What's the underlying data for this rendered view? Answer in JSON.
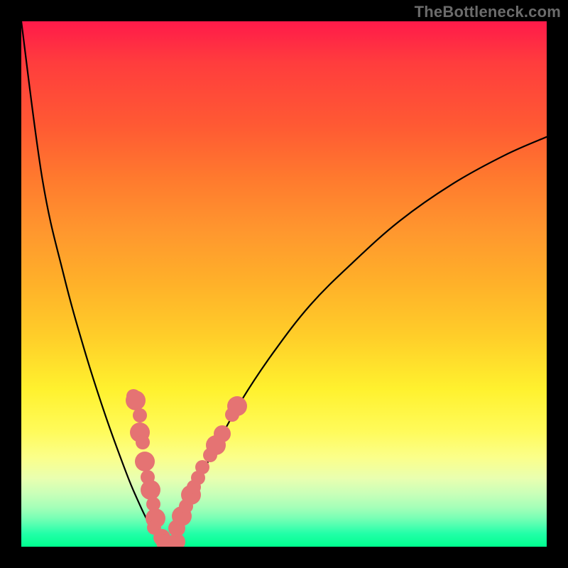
{
  "watermark": "TheBottleneck.com",
  "chart_data": {
    "type": "line",
    "title": "",
    "xlabel": "",
    "ylabel": "",
    "xlim": [
      0,
      1
    ],
    "ylim": [
      0,
      1
    ],
    "grid": false,
    "series": [
      {
        "name": "left-arm",
        "x": [
          0.0,
          0.04,
          0.08,
          0.12,
          0.16,
          0.2,
          0.22,
          0.24,
          0.26,
          0.272,
          0.28
        ],
        "y": [
          1.0,
          0.7,
          0.52,
          0.375,
          0.25,
          0.14,
          0.092,
          0.05,
          0.02,
          0.003,
          0.0
        ]
      },
      {
        "name": "right-arm",
        "x": [
          0.28,
          0.3,
          0.33,
          0.37,
          0.42,
          0.48,
          0.55,
          0.63,
          0.72,
          0.82,
          0.92,
          1.0
        ],
        "y": [
          0.0,
          0.045,
          0.11,
          0.19,
          0.28,
          0.37,
          0.46,
          0.54,
          0.62,
          0.69,
          0.745,
          0.78
        ]
      }
    ],
    "dots": {
      "name": "highlighted-range",
      "color": "#e57373",
      "points": [
        {
          "x": 0.214,
          "y": 0.287,
          "r": 10
        },
        {
          "x": 0.217,
          "y": 0.279,
          "r": 14
        },
        {
          "x": 0.226,
          "y": 0.25,
          "r": 10
        },
        {
          "x": 0.225,
          "y": 0.217,
          "r": 14
        },
        {
          "x": 0.231,
          "y": 0.198,
          "r": 10
        },
        {
          "x": 0.235,
          "y": 0.162,
          "r": 14
        },
        {
          "x": 0.241,
          "y": 0.133,
          "r": 10
        },
        {
          "x": 0.246,
          "y": 0.108,
          "r": 14
        },
        {
          "x": 0.251,
          "y": 0.081,
          "r": 10
        },
        {
          "x": 0.256,
          "y": 0.054,
          "r": 14
        },
        {
          "x": 0.253,
          "y": 0.037,
          "r": 10
        },
        {
          "x": 0.267,
          "y": 0.018,
          "r": 12
        },
        {
          "x": 0.273,
          "y": 0.008,
          "r": 12
        },
        {
          "x": 0.286,
          "y": 0.006,
          "r": 12
        },
        {
          "x": 0.296,
          "y": 0.01,
          "r": 12
        },
        {
          "x": 0.296,
          "y": 0.035,
          "r": 12
        },
        {
          "x": 0.306,
          "y": 0.058,
          "r": 14
        },
        {
          "x": 0.313,
          "y": 0.077,
          "r": 10
        },
        {
          "x": 0.323,
          "y": 0.098,
          "r": 14
        },
        {
          "x": 0.329,
          "y": 0.113,
          "r": 10
        },
        {
          "x": 0.336,
          "y": 0.131,
          "r": 10
        },
        {
          "x": 0.344,
          "y": 0.151,
          "r": 10
        },
        {
          "x": 0.36,
          "y": 0.174,
          "r": 10
        },
        {
          "x": 0.37,
          "y": 0.193,
          "r": 14
        },
        {
          "x": 0.383,
          "y": 0.215,
          "r": 12
        },
        {
          "x": 0.402,
          "y": 0.252,
          "r": 10
        },
        {
          "x": 0.411,
          "y": 0.268,
          "r": 14
        }
      ]
    }
  }
}
